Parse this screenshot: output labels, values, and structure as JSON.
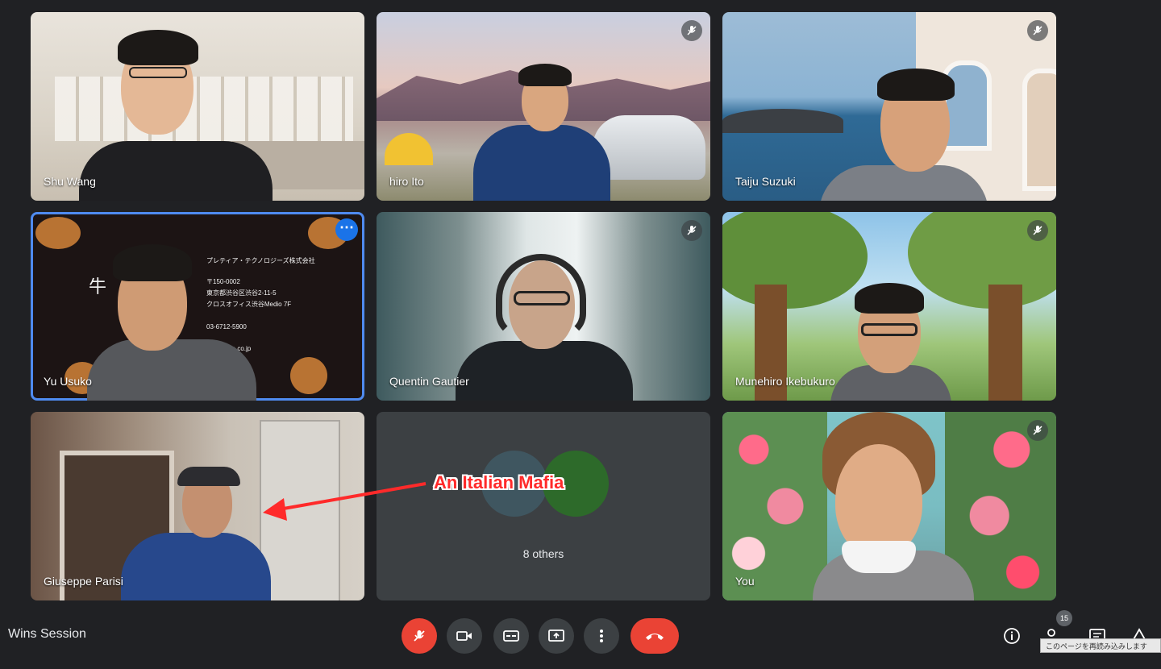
{
  "meeting": {
    "title": "Wins Session"
  },
  "tiles": [
    {
      "name": "Shu Wang",
      "muted": false
    },
    {
      "name": "hiro Ito",
      "muted": true
    },
    {
      "name": "Taiju Suzuki",
      "muted": true
    },
    {
      "name": "Yu Usuko",
      "muted": false,
      "active": true
    },
    {
      "name": "Quentin Gautier",
      "muted": true
    },
    {
      "name": "Munehiro Ikebukuro",
      "muted": true
    },
    {
      "name": "Giuseppe Parisi",
      "muted": false
    },
    {
      "name": "8 others",
      "muted": false
    },
    {
      "name": "You",
      "muted": true
    }
  ],
  "business_card": {
    "company": "プレティア・テクノロジーズ株式会社",
    "kanji": "牛",
    "zip": "〒150-0002",
    "address1": "東京都渋谷区渋谷2-11-5",
    "address2": "クロスオフィス渋谷Medio 7F",
    "phone": "03-6712-5900",
    "email": "@pretia.co.jp"
  },
  "annotation": {
    "text": "An Italian Mafia"
  },
  "controls": {
    "badge_count": "15",
    "tooltip": "このページを再読み込みします"
  },
  "colors": {
    "accent": "#1a73e8",
    "danger": "#ea4335",
    "bg": "#202124",
    "annotation": "#ff2a2a"
  }
}
